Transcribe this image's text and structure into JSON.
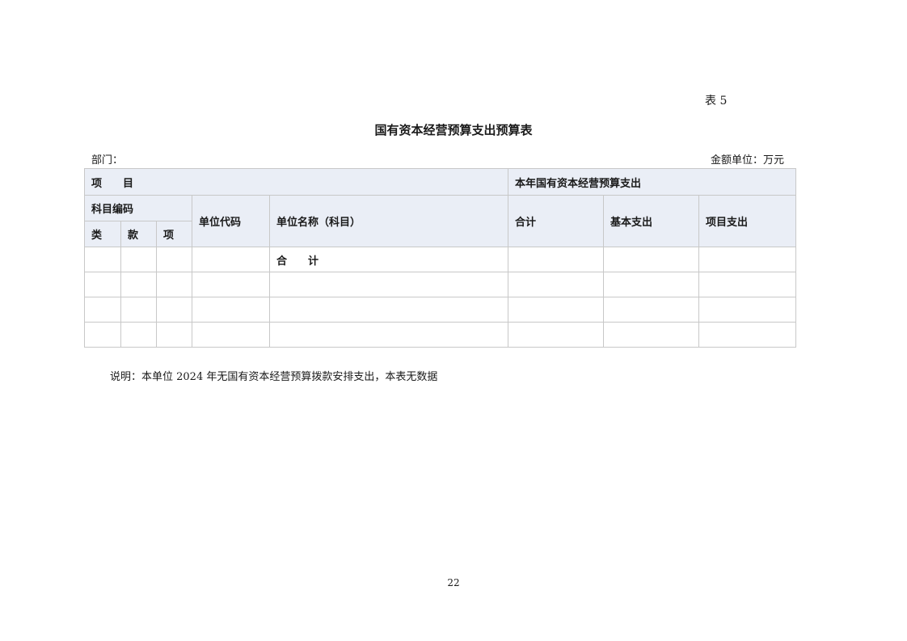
{
  "header": {
    "table_label": "表 5",
    "title": "国有资本经营预算支出预算表",
    "dept_label": "部门：",
    "unit_label": "金额单位：万元"
  },
  "table": {
    "headers": {
      "item": "项　　目",
      "current_year_expenditure": "本年国有资本经营预算支出",
      "subject_code": "科目编码",
      "unit_code": "单位代码",
      "unit_name": "单位名称（科目）",
      "total": "合计",
      "basic_expenditure": "基本支出",
      "project_expenditure": "项目支出",
      "category": "类",
      "section": "款",
      "subitem": "项"
    },
    "rows": [
      {
        "category": "",
        "section": "",
        "subitem": "",
        "unit_code": "",
        "unit_name": "合　　计",
        "total": "",
        "basic": "",
        "project": ""
      },
      {
        "category": "",
        "section": "",
        "subitem": "",
        "unit_code": "",
        "unit_name": "",
        "total": "",
        "basic": "",
        "project": ""
      },
      {
        "category": "",
        "section": "",
        "subitem": "",
        "unit_code": "",
        "unit_name": "",
        "total": "",
        "basic": "",
        "project": ""
      },
      {
        "category": "",
        "section": "",
        "subitem": "",
        "unit_code": "",
        "unit_name": "",
        "total": "",
        "basic": "",
        "project": ""
      }
    ]
  },
  "note": "说明：本单位 2024 年无国有资本经营预算拨款安排支出，本表无数据",
  "page_number": "22"
}
